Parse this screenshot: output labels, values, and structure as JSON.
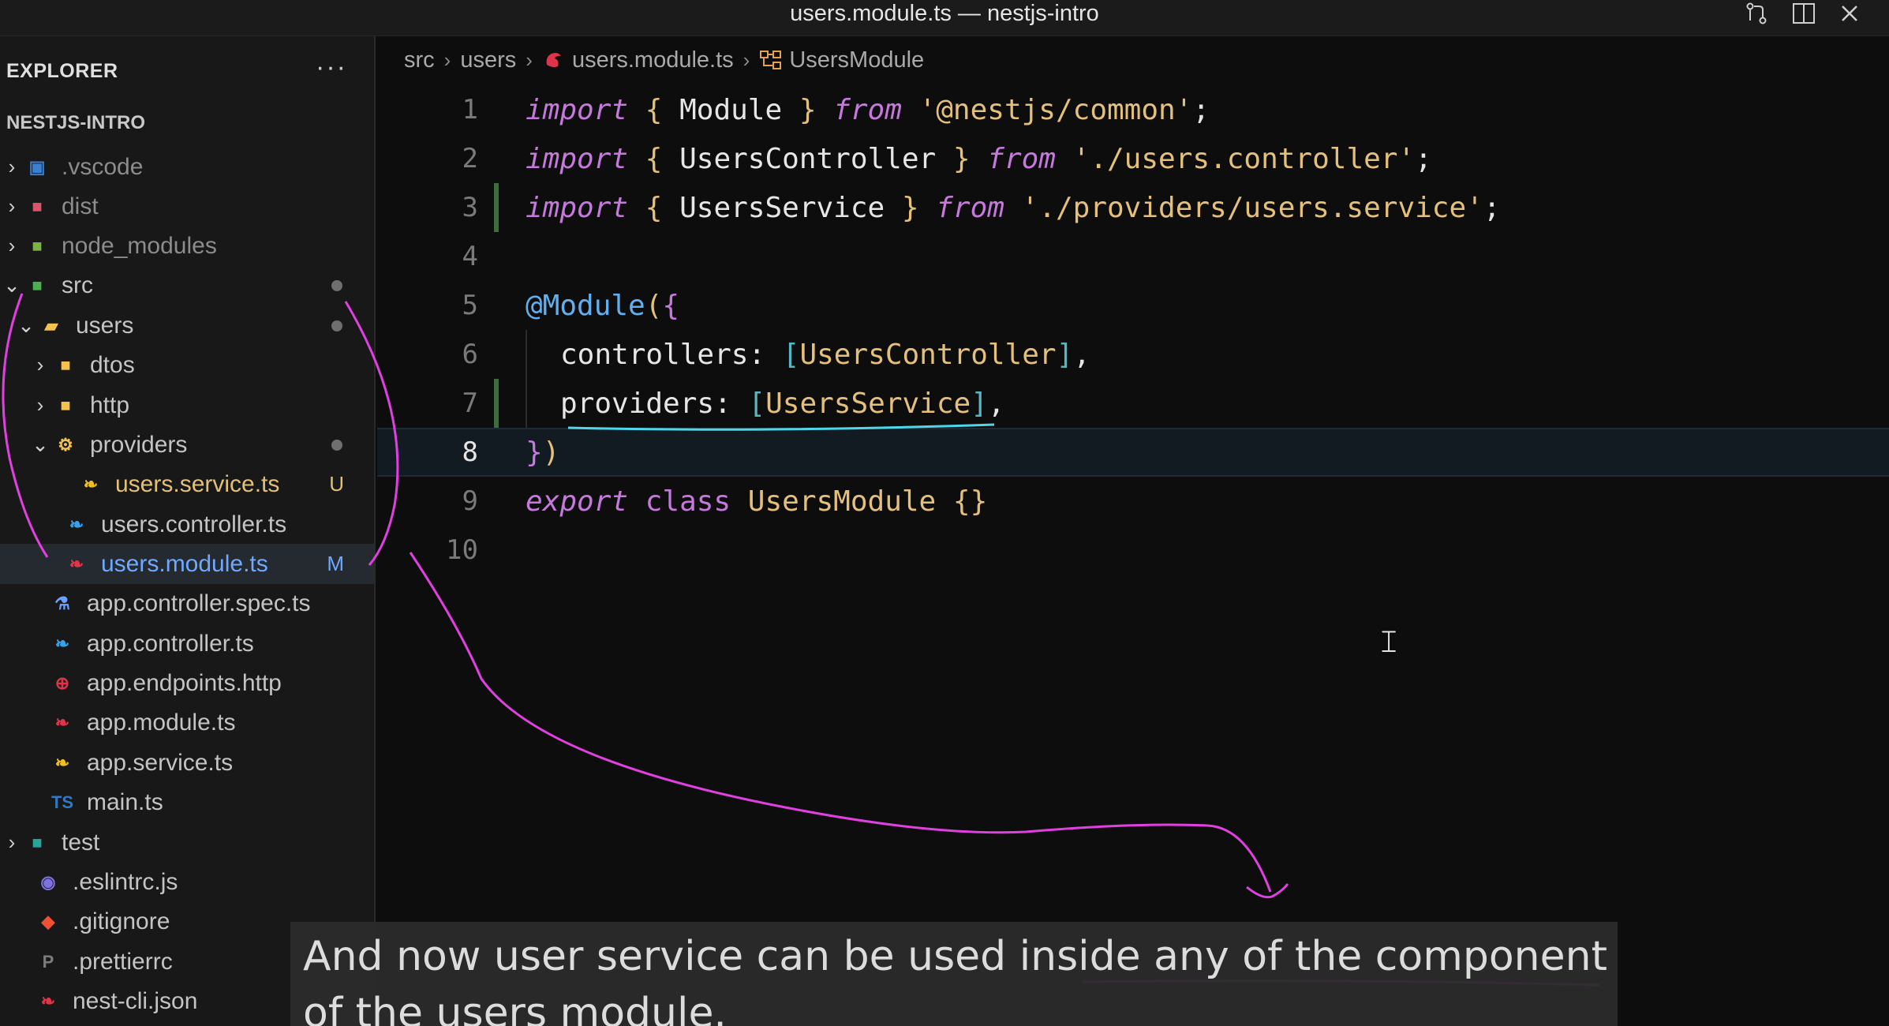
{
  "window": {
    "title": "users.module.ts — nestjs-intro",
    "icons": [
      "source-control-icon",
      "split-editor-icon",
      "close-icon"
    ]
  },
  "explorer": {
    "header": "EXPLORER",
    "more": "···",
    "project": "NESTJS-INTRO",
    "items": [
      {
        "label": ".vscode",
        "icon": "vscode-folder-icon",
        "chevron": "›",
        "status": ""
      },
      {
        "label": "dist",
        "icon": "dist-folder-icon",
        "chevron": "›",
        "status": ""
      },
      {
        "label": "node_modules",
        "icon": "node-folder-icon",
        "chevron": "›",
        "status": ""
      },
      {
        "label": "src",
        "icon": "src-folder-icon",
        "chevron": "⌄",
        "status": "dot"
      },
      {
        "label": "users",
        "icon": "folder-open-icon",
        "chevron": "⌄",
        "status": "dot"
      },
      {
        "label": "dtos",
        "icon": "folder-icon",
        "chevron": "›",
        "status": ""
      },
      {
        "label": "http",
        "icon": "folder-icon",
        "chevron": "›",
        "status": ""
      },
      {
        "label": "providers",
        "icon": "providers-folder-icon",
        "chevron": "⌄",
        "status": "dot"
      },
      {
        "label": "users.service.ts",
        "icon": "nest-service-icon",
        "chevron": "",
        "status": "U"
      },
      {
        "label": "users.controller.ts",
        "icon": "nest-controller-icon",
        "chevron": "",
        "status": ""
      },
      {
        "label": "users.module.ts",
        "icon": "nest-module-icon",
        "chevron": "",
        "status": "M"
      },
      {
        "label": "app.controller.spec.ts",
        "icon": "test-flask-icon",
        "chevron": "",
        "status": ""
      },
      {
        "label": "app.controller.ts",
        "icon": "nest-controller-icon",
        "chevron": "",
        "status": ""
      },
      {
        "label": "app.endpoints.http",
        "icon": "http-globe-icon",
        "chevron": "",
        "status": ""
      },
      {
        "label": "app.module.ts",
        "icon": "nest-module-icon",
        "chevron": "",
        "status": ""
      },
      {
        "label": "app.service.ts",
        "icon": "nest-service-icon",
        "chevron": "",
        "status": ""
      },
      {
        "label": "main.ts",
        "icon": "typescript-icon",
        "chevron": "",
        "status": ""
      },
      {
        "label": "test",
        "icon": "test-folder-icon",
        "chevron": "›",
        "status": ""
      },
      {
        "label": ".eslintrc.js",
        "icon": "eslint-icon",
        "chevron": "",
        "status": ""
      },
      {
        "label": ".gitignore",
        "icon": "git-icon",
        "chevron": "",
        "status": ""
      },
      {
        "label": ".prettierrc",
        "icon": "prettier-icon",
        "chevron": "",
        "status": ""
      },
      {
        "label": "nest-cli.json",
        "icon": "nest-cli-icon",
        "chevron": "",
        "status": ""
      }
    ]
  },
  "breadcrumb": {
    "parts": [
      "src",
      "users",
      "users.module.ts",
      "UsersModule"
    ]
  },
  "editor": {
    "lines": [
      {
        "n": "1",
        "tokens": [
          [
            "kw",
            "import"
          ],
          [
            "id",
            " "
          ],
          [
            "br",
            "{"
          ],
          [
            "id",
            " Module "
          ],
          [
            "br",
            "}"
          ],
          [
            "id",
            " "
          ],
          [
            "kw",
            "from"
          ],
          [
            "id",
            " "
          ],
          [
            "str",
            "'@nestjs/common'"
          ],
          [
            "pun",
            ";"
          ]
        ]
      },
      {
        "n": "2",
        "tokens": [
          [
            "kw",
            "import"
          ],
          [
            "id",
            " "
          ],
          [
            "br",
            "{"
          ],
          [
            "id",
            " UsersController "
          ],
          [
            "br",
            "}"
          ],
          [
            "id",
            " "
          ],
          [
            "kw",
            "from"
          ],
          [
            "id",
            " "
          ],
          [
            "str",
            "'./users.controller'"
          ],
          [
            "pun",
            ";"
          ]
        ]
      },
      {
        "n": "3",
        "tokens": [
          [
            "kw",
            "import"
          ],
          [
            "id",
            " "
          ],
          [
            "br",
            "{"
          ],
          [
            "id",
            " UsersService "
          ],
          [
            "br",
            "}"
          ],
          [
            "id",
            " "
          ],
          [
            "kw",
            "from"
          ],
          [
            "id",
            " "
          ],
          [
            "str",
            "'./providers/users.service'"
          ],
          [
            "pun",
            ";"
          ]
        ]
      },
      {
        "n": "4",
        "tokens": []
      },
      {
        "n": "5",
        "tokens": [
          [
            "dec",
            "@Module"
          ],
          [
            "br",
            "("
          ],
          [
            "br2",
            "{"
          ]
        ]
      },
      {
        "n": "6",
        "tokens": [
          [
            "indent",
            ""
          ],
          [
            "prop",
            "controllers: "
          ],
          [
            "br3",
            "["
          ],
          [
            "cls",
            "UsersController"
          ],
          [
            "br3",
            "]"
          ],
          [
            "pun",
            ","
          ]
        ]
      },
      {
        "n": "7",
        "tokens": [
          [
            "indent",
            ""
          ],
          [
            "prop",
            "providers: "
          ],
          [
            "br3",
            "["
          ],
          [
            "cls",
            "UsersService"
          ],
          [
            "br3",
            "]"
          ],
          [
            "pun",
            ","
          ]
        ]
      },
      {
        "n": "8",
        "tokens": [
          [
            "br2",
            "}"
          ],
          [
            "br",
            ")"
          ]
        ]
      },
      {
        "n": "9",
        "tokens": [
          [
            "kw",
            "export"
          ],
          [
            "id",
            " "
          ],
          [
            "kw2",
            "class"
          ],
          [
            "id",
            " "
          ],
          [
            "cls",
            "UsersModule"
          ],
          [
            "id",
            " "
          ],
          [
            "br",
            "{}"
          ]
        ]
      },
      {
        "n": "10",
        "tokens": []
      }
    ],
    "current_line": "8",
    "modified_lines": [
      "3",
      "7"
    ]
  },
  "caption": {
    "text": "And now user service can be used inside any of the component of the users module."
  },
  "colors": {
    "annotation": "#e040e0",
    "underline_cyan": "#4fd6e8"
  }
}
